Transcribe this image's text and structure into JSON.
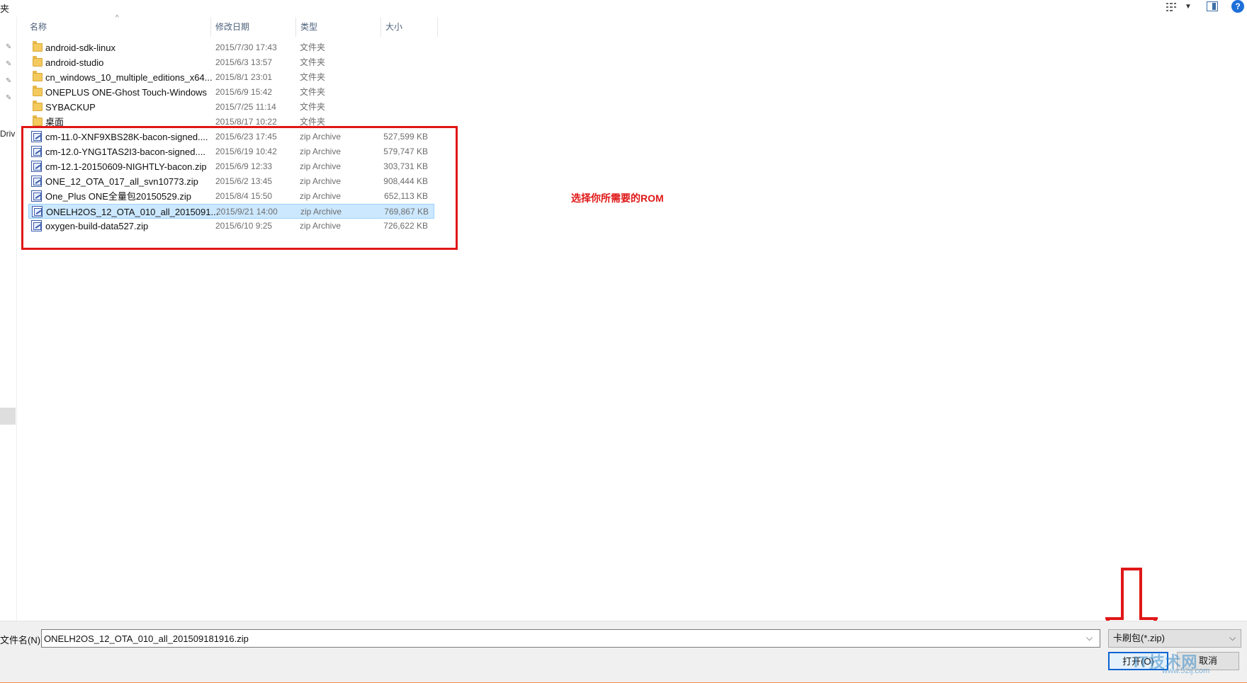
{
  "header": {
    "crumb_tail": "夹",
    "columns": {
      "name": "名称",
      "date": "修改日期",
      "type": "类型",
      "size": "大小"
    }
  },
  "nav": {
    "label_fragment": "Driv"
  },
  "files": [
    {
      "name": "android-sdk-linux",
      "date": "2015/7/30 17:43",
      "type": "文件夹",
      "size": "",
      "icon": "folder-icon"
    },
    {
      "name": "android-studio",
      "date": "2015/6/3 13:57",
      "type": "文件夹",
      "size": "",
      "icon": "folder-icon"
    },
    {
      "name": "cn_windows_10_multiple_editions_x64...",
      "date": "2015/8/1 23:01",
      "type": "文件夹",
      "size": "",
      "icon": "folder-icon"
    },
    {
      "name": "ONEPLUS ONE-Ghost Touch-Windows",
      "date": "2015/6/9 15:42",
      "type": "文件夹",
      "size": "",
      "icon": "folder-icon"
    },
    {
      "name": "SYBACKUP",
      "date": "2015/7/25 11:14",
      "type": "文件夹",
      "size": "",
      "icon": "folder-icon"
    },
    {
      "name": "桌面",
      "date": "2015/8/17 10:22",
      "type": "文件夹",
      "size": "",
      "icon": "folder-icon"
    },
    {
      "name": "cm-11.0-XNF9XBS28K-bacon-signed....",
      "date": "2015/6/23 17:45",
      "type": "zip Archive",
      "size": "527,599 KB",
      "icon": "zip-icon"
    },
    {
      "name": "cm-12.0-YNG1TAS2I3-bacon-signed....",
      "date": "2015/6/19 10:42",
      "type": "zip Archive",
      "size": "579,747 KB",
      "icon": "zip-icon"
    },
    {
      "name": "cm-12.1-20150609-NIGHTLY-bacon.zip",
      "date": "2015/6/9 12:33",
      "type": "zip Archive",
      "size": "303,731 KB",
      "icon": "zip-icon"
    },
    {
      "name": "ONE_12_OTA_017_all_svn10773.zip",
      "date": "2015/6/2 13:45",
      "type": "zip Archive",
      "size": "908,444 KB",
      "icon": "zip-icon"
    },
    {
      "name": "One_Plus ONE全量包20150529.zip",
      "date": "2015/8/4 15:50",
      "type": "zip Archive",
      "size": "652,113 KB",
      "icon": "zip-icon"
    },
    {
      "name": "ONELH2OS_12_OTA_010_all_2015091...",
      "date": "2015/9/21 14:00",
      "type": "zip Archive",
      "size": "769,867 KB",
      "icon": "zip-icon",
      "selected": true
    },
    {
      "name": "oxygen-build-data527.zip",
      "date": "2015/6/10 9:25",
      "type": "zip Archive",
      "size": "726,622 KB",
      "icon": "zip-icon"
    }
  ],
  "annotation": {
    "text": "选择你所需要的ROM",
    "color": "#e01717"
  },
  "footer": {
    "filename_label": "文件名(N):",
    "filename_value": "ONELH2OS_12_OTA_010_all_201509181916.zip",
    "filter_value": "卡刷包(*.zip)",
    "open_label": "打开(O)",
    "cancel_label": "取消"
  },
  "watermark": {
    "text": "IT技术网",
    "sub": "www.52ij.com"
  },
  "colors": {
    "selection": "#cce8ff",
    "accent": "#0a64d0",
    "folder": "#f4c95d"
  }
}
